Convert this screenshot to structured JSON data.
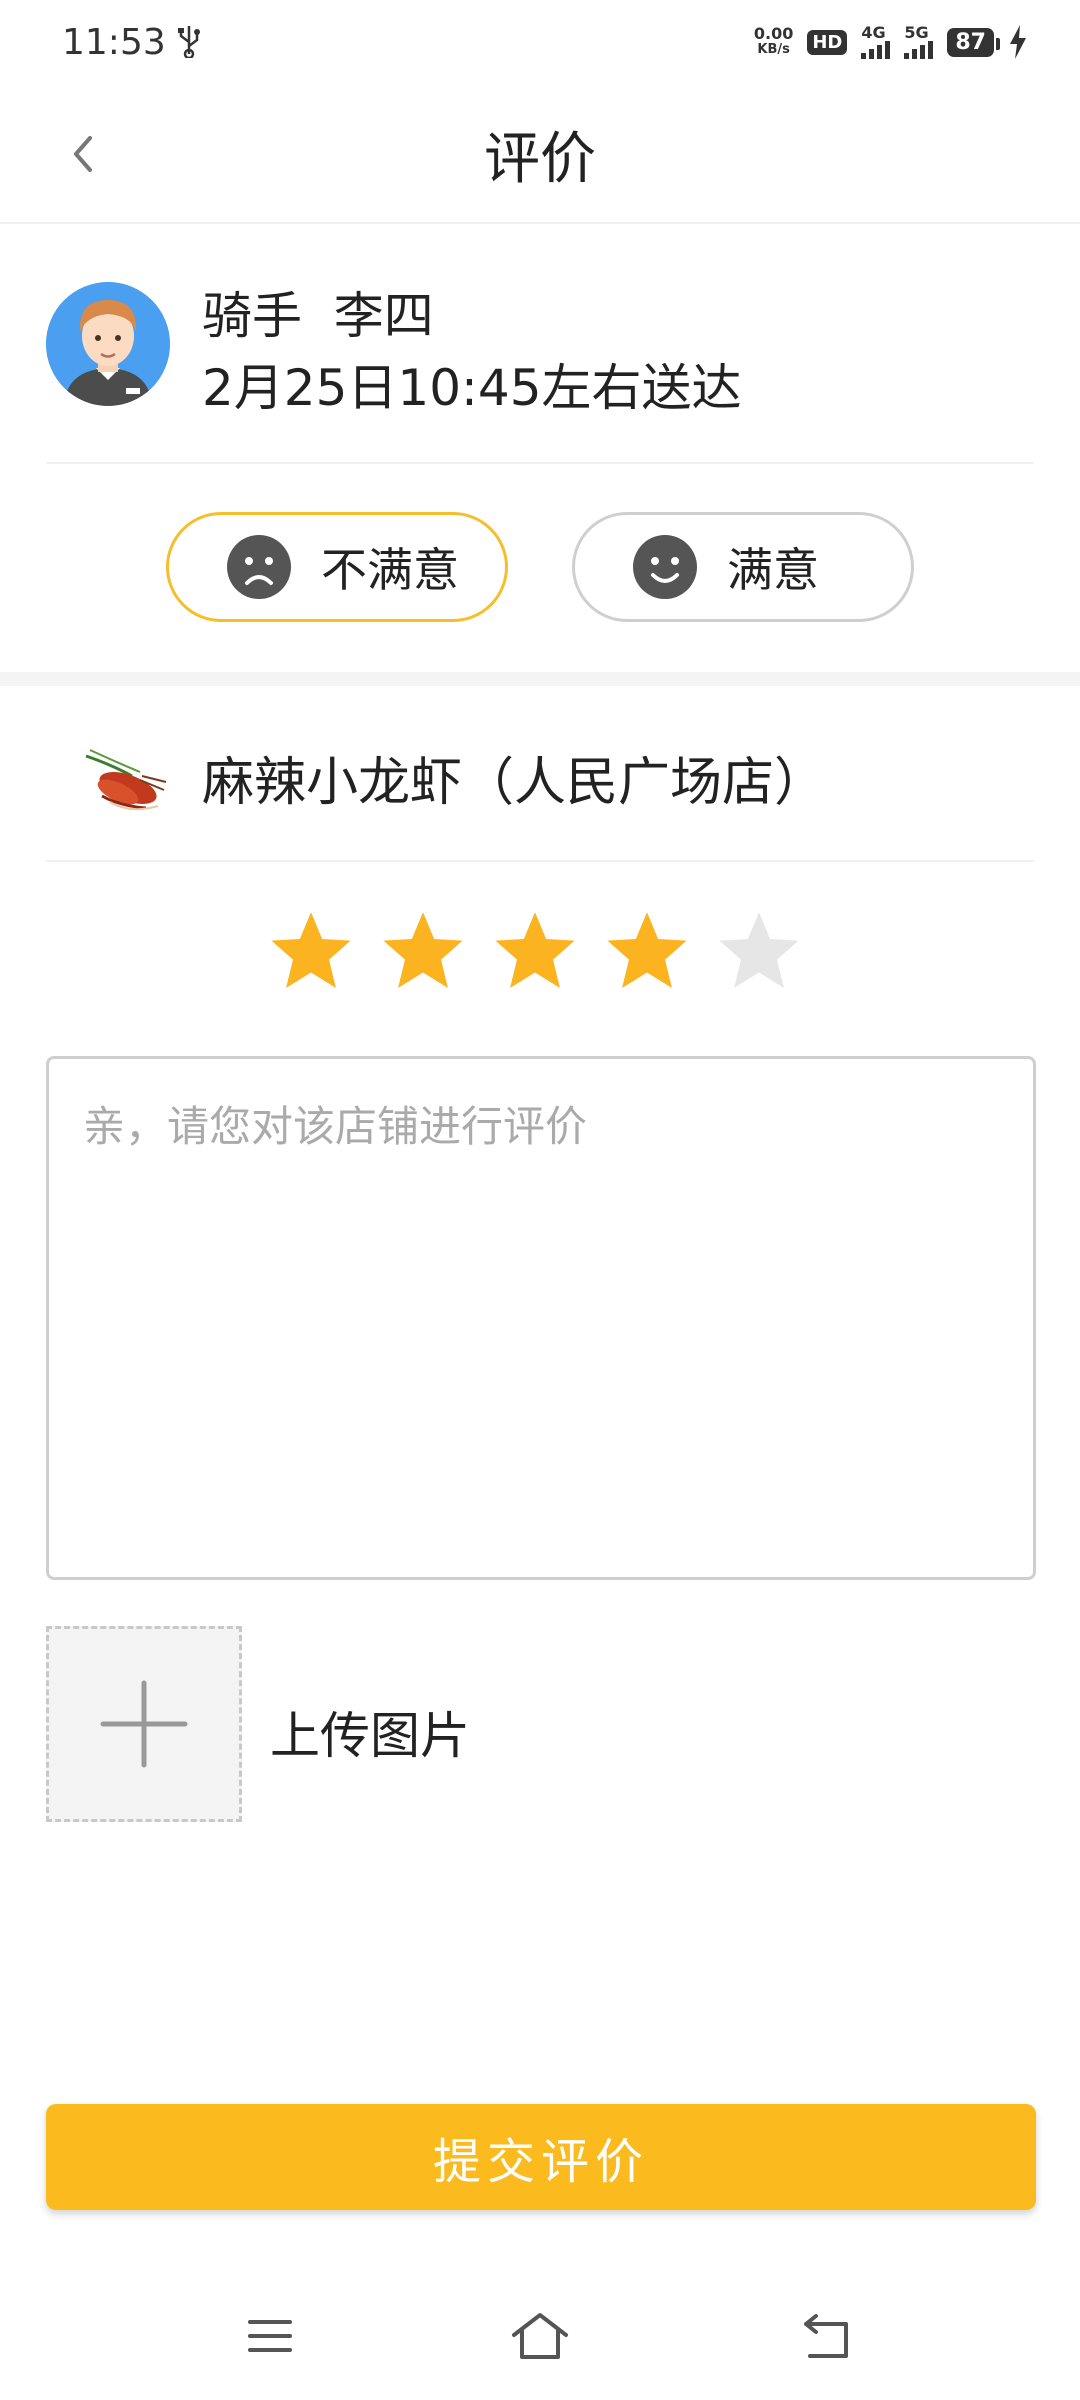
{
  "status_bar": {
    "time": "11:53",
    "speed_value": "0.00",
    "speed_unit": "KB/s",
    "hd": "HD",
    "network1": "4G",
    "network2": "5G",
    "battery": "87"
  },
  "header": {
    "title": "评价"
  },
  "rider": {
    "name": "骑手  李四",
    "delivery_time": "2月25日10:45左右送达",
    "options": [
      {
        "label": "不满意",
        "selected": true
      },
      {
        "label": "满意",
        "selected": false
      }
    ]
  },
  "store": {
    "name": "麻辣小龙虾（人民广场店）",
    "rating": 4,
    "rating_max": 5
  },
  "review": {
    "placeholder": "亲，请您对该店铺进行评价",
    "value": ""
  },
  "upload": {
    "label": "上传图片"
  },
  "submit": {
    "label": "提交评价"
  },
  "colors": {
    "accent": "#fbbb1f",
    "star_on": "#fbb41f",
    "star_off": "#e6e6e6",
    "selected_border": "#f6be2c"
  }
}
